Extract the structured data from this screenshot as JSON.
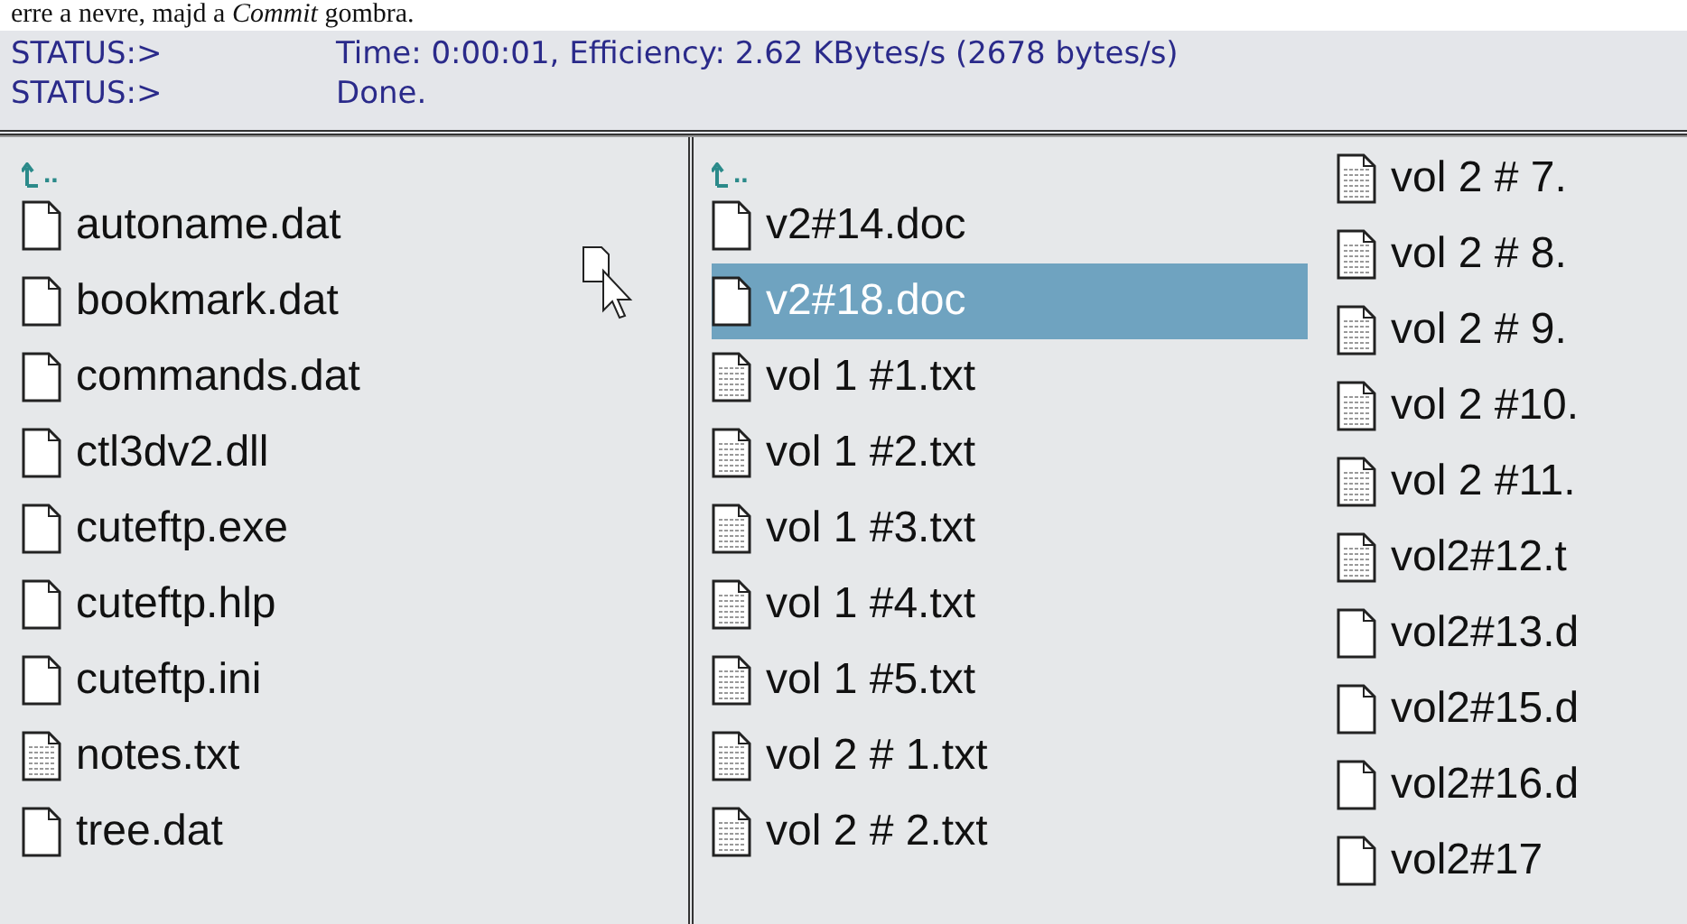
{
  "caption": "erre a nevre, majd a *Commit* gombra.",
  "status_log": [
    {
      "label": "STATUS:>",
      "message": "Time: 0:00:01, Efficiency: 2.62 KBytes/s (2678 bytes/s)"
    },
    {
      "label": "STATUS:>",
      "message": "Done."
    }
  ],
  "local_pane": {
    "parent": "..",
    "files": [
      {
        "name": "autoname.dat",
        "kind": "doc",
        "selected": false
      },
      {
        "name": "bookmark.dat",
        "kind": "doc",
        "selected": false
      },
      {
        "name": "commands.dat",
        "kind": "doc",
        "selected": false
      },
      {
        "name": "ctl3dv2.dll",
        "kind": "doc",
        "selected": false
      },
      {
        "name": "cuteftp.exe",
        "kind": "doc",
        "selected": false
      },
      {
        "name": "cuteftp.hlp",
        "kind": "doc",
        "selected": false
      },
      {
        "name": "cuteftp.ini",
        "kind": "doc",
        "selected": false
      },
      {
        "name": "notes.txt",
        "kind": "txt",
        "selected": false
      },
      {
        "name": "tree.dat",
        "kind": "doc",
        "selected": false
      }
    ]
  },
  "remote_pane": {
    "parent": "..",
    "columns": [
      [
        {
          "name": "v2#14.doc",
          "kind": "doc",
          "selected": false
        },
        {
          "name": "v2#18.doc",
          "kind": "doc",
          "selected": true
        },
        {
          "name": "vol 1 #1.txt",
          "kind": "txt",
          "selected": false
        },
        {
          "name": "vol 1 #2.txt",
          "kind": "txt",
          "selected": false
        },
        {
          "name": "vol 1 #3.txt",
          "kind": "txt",
          "selected": false
        },
        {
          "name": "vol 1 #4.txt",
          "kind": "txt",
          "selected": false
        },
        {
          "name": "vol 1 #5.txt",
          "kind": "txt",
          "selected": false
        },
        {
          "name": "vol 2 # 1.txt",
          "kind": "txt",
          "selected": false
        },
        {
          "name": "vol 2 # 2.txt",
          "kind": "txt",
          "selected": false
        }
      ],
      [
        {
          "name": "vol 2 # 7.",
          "kind": "txt",
          "selected": false
        },
        {
          "name": "vol 2 # 8.",
          "kind": "txt",
          "selected": false
        },
        {
          "name": "vol 2 # 9.",
          "kind": "txt",
          "selected": false
        },
        {
          "name": "vol 2 #10.",
          "kind": "txt",
          "selected": false
        },
        {
          "name": "vol 2 #11.",
          "kind": "txt",
          "selected": false
        },
        {
          "name": "vol2#12.t",
          "kind": "txt",
          "selected": false
        },
        {
          "name": "vol2#13.d",
          "kind": "doc",
          "selected": false
        },
        {
          "name": "vol2#15.d",
          "kind": "doc",
          "selected": false
        },
        {
          "name": "vol2#16.d",
          "kind": "doc",
          "selected": false
        },
        {
          "name": "vol2#17",
          "kind": "doc",
          "selected": false
        }
      ]
    ]
  }
}
